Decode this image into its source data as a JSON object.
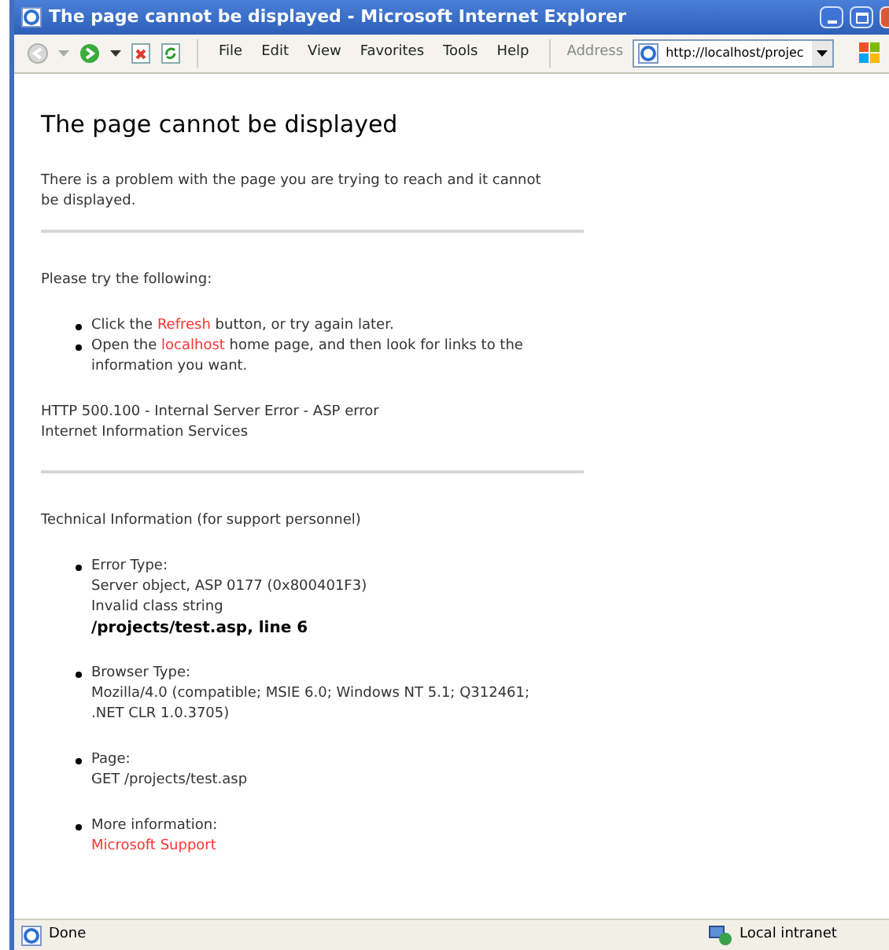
{
  "window": {
    "title": "The page cannot be displayed - Microsoft Internet Explorer"
  },
  "menu": [
    "File",
    "Edit",
    "View",
    "Favorites",
    "Tools",
    "Help"
  ],
  "address": {
    "label": "Address",
    "value": "http://localhost/projec"
  },
  "page": {
    "heading": "The page cannot be displayed",
    "intro": "There is a problem with the page you are trying to reach and it cannot be displayed.",
    "try_heading": "Please try the following:",
    "suggestions": [
      [
        {
          "kind": "text",
          "text": "Click the "
        },
        {
          "kind": "link",
          "text": "Refresh"
        },
        {
          "kind": "text",
          "text": " button, or try again later."
        }
      ],
      [
        {
          "kind": "text",
          "text": "Open the "
        },
        {
          "kind": "link",
          "text": "localhost"
        },
        {
          "kind": "text",
          "text": " home page, and then look for links to the information you want."
        }
      ]
    ],
    "error_lines": [
      "HTTP 500.100 - Internal Server Error - ASP error",
      "Internet Information Services"
    ],
    "tech_heading": "Technical Information (for support personnel)",
    "tech_items": [
      {
        "label": "Error Type:",
        "lines": [
          {
            "kind": "plain",
            "text": "Server object, ASP 0177 (0x800401F3)"
          },
          {
            "kind": "plain",
            "text": "Invalid class string"
          },
          {
            "kind": "bold",
            "text": "/projects/test.asp, line 6"
          }
        ]
      },
      {
        "label": "Browser Type:",
        "lines": [
          {
            "kind": "plain",
            "text": "Mozilla/4.0 (compatible; MSIE 6.0; Windows NT 5.1; Q312461; .NET CLR 1.0.3705)"
          }
        ]
      },
      {
        "label": "Page:",
        "lines": [
          {
            "kind": "plain",
            "text": "GET /projects/test.asp"
          }
        ]
      },
      {
        "label": "More information:",
        "lines": [
          {
            "kind": "link",
            "text": "Microsoft Support"
          }
        ]
      }
    ]
  },
  "status_bar": {
    "text": "Done",
    "zone": "Local intranet"
  }
}
